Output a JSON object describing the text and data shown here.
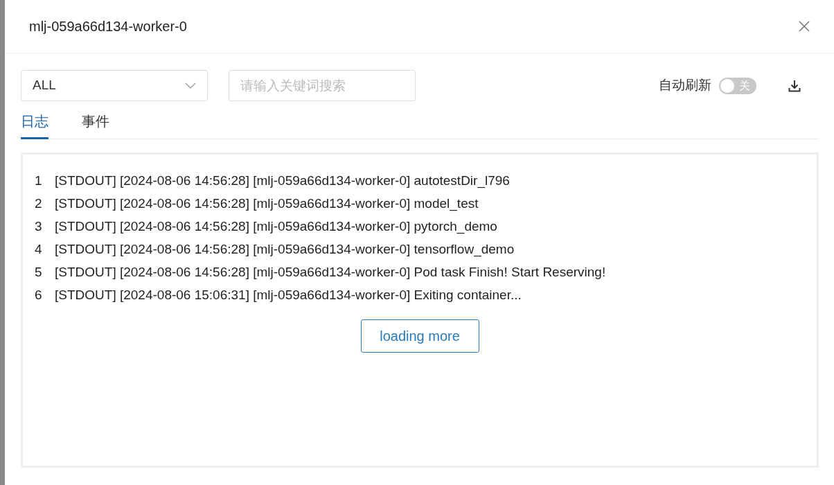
{
  "dialog": {
    "title": "mlj-059a66d134-worker-0"
  },
  "filter": {
    "value": "ALL"
  },
  "search": {
    "placeholder": "请输入关键词搜索"
  },
  "auto_refresh": {
    "label": "自动刷新",
    "on": false,
    "toggle_text": "关"
  },
  "tabs": [
    {
      "label": "日志",
      "selected": true
    },
    {
      "label": "事件",
      "selected": false
    }
  ],
  "log_lines": [
    {
      "number": "1",
      "text": "[STDOUT] [2024-08-06 14:56:28] [mlj-059a66d134-worker-0] autotestDir_l796"
    },
    {
      "number": "2",
      "text": "[STDOUT] [2024-08-06 14:56:28] [mlj-059a66d134-worker-0] model_test"
    },
    {
      "number": "3",
      "text": "[STDOUT] [2024-08-06 14:56:28] [mlj-059a66d134-worker-0] pytorch_demo"
    },
    {
      "number": "4",
      "text": "[STDOUT] [2024-08-06 14:56:28] [mlj-059a66d134-worker-0] tensorflow_demo"
    },
    {
      "number": "5",
      "text": "[STDOUT] [2024-08-06 14:56:28] [mlj-059a66d134-worker-0] Pod task Finish! Start Reserving!"
    },
    {
      "number": "6",
      "text": "[STDOUT] [2024-08-06 15:06:31] [mlj-059a66d134-worker-0] Exiting container..."
    }
  ],
  "load_more_button": "loading more"
}
